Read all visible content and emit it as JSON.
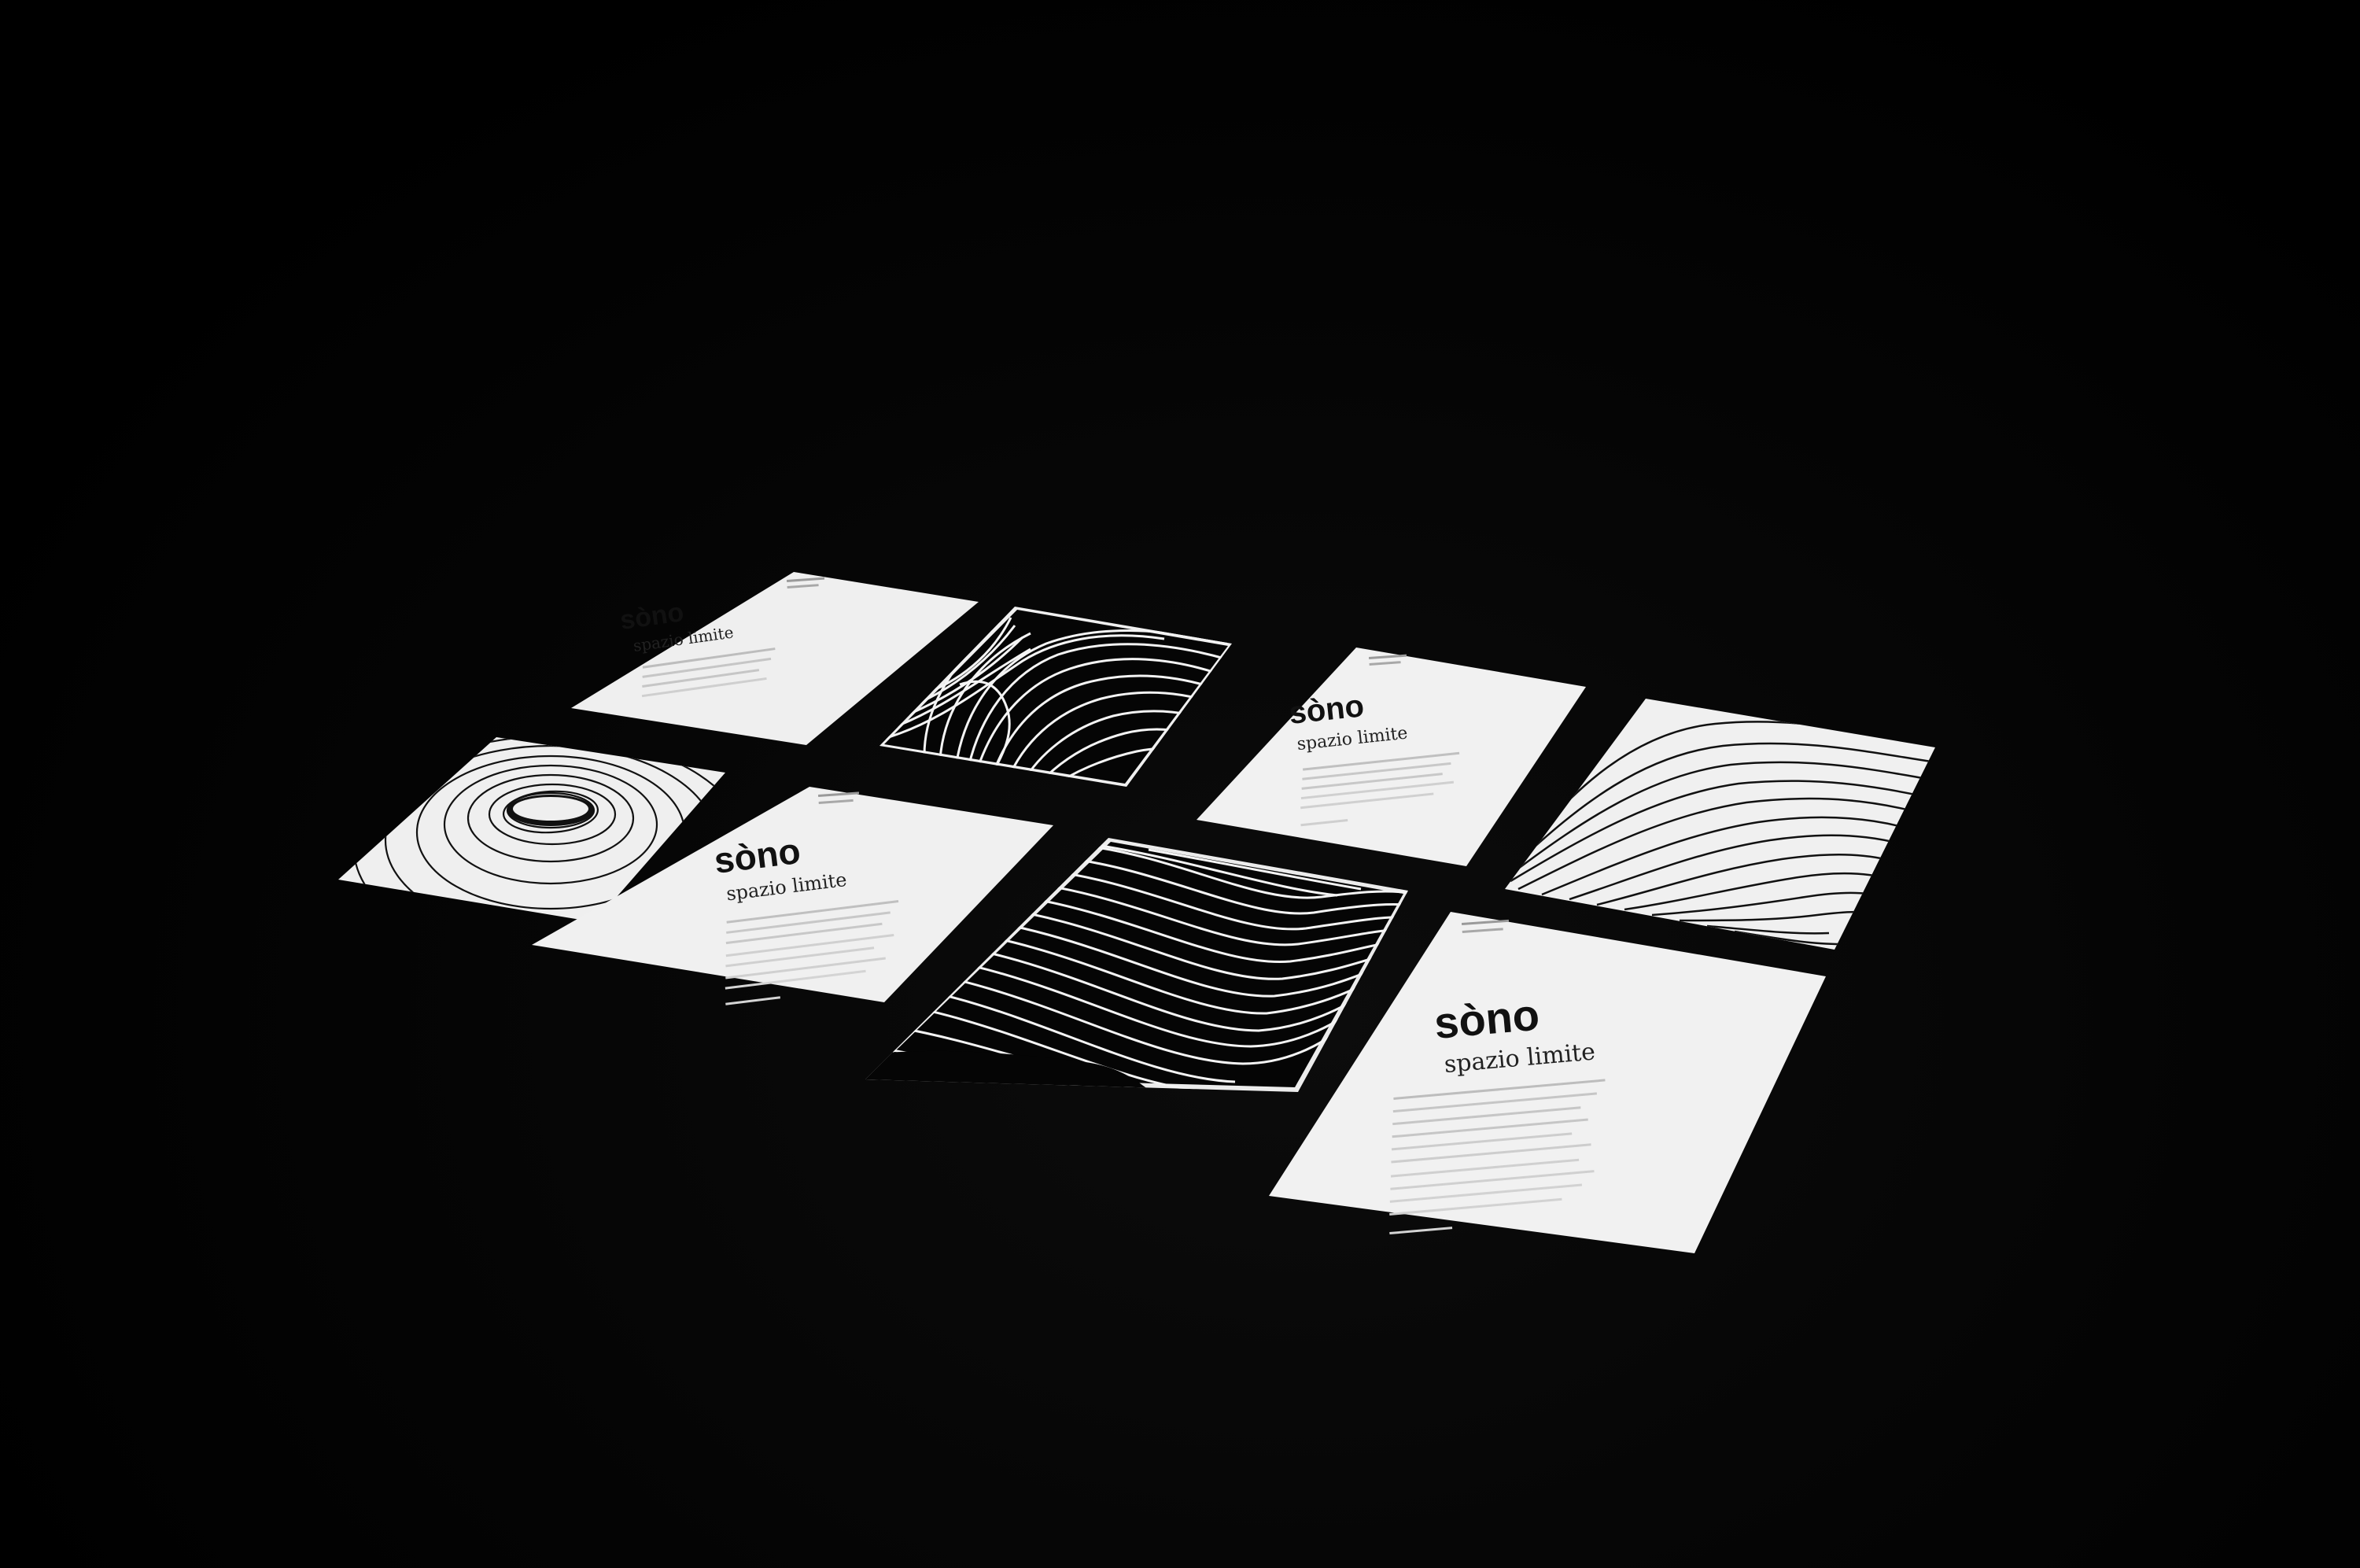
{
  "scene": {
    "background_color": "#000000",
    "card_white": "#f2f2f2",
    "card_black": "#050505",
    "line_color_on_white": "#111111",
    "line_color_on_black": "#f4f4f4"
  },
  "cards": {
    "c1": {
      "kind": "text-card",
      "title": "sòno",
      "subtitle": "spazio limite"
    },
    "c2": {
      "kind": "pattern-card",
      "pattern": "sphere-lines-white-on-black"
    },
    "c3": {
      "kind": "text-card",
      "title": "sòno",
      "subtitle": "spazio limite"
    },
    "c4": {
      "kind": "pattern-card",
      "pattern": "wave-lines-black-on-white"
    },
    "c5": {
      "kind": "pattern-card",
      "pattern": "concentric-rings-black-on-white"
    },
    "c6": {
      "kind": "text-card",
      "title": "sòno",
      "subtitle": "spazio limite"
    },
    "c7": {
      "kind": "pattern-card",
      "pattern": "wave-lines-white-on-black"
    },
    "c8": {
      "kind": "text-card",
      "title": "sòno",
      "subtitle": "spazio limite"
    }
  }
}
